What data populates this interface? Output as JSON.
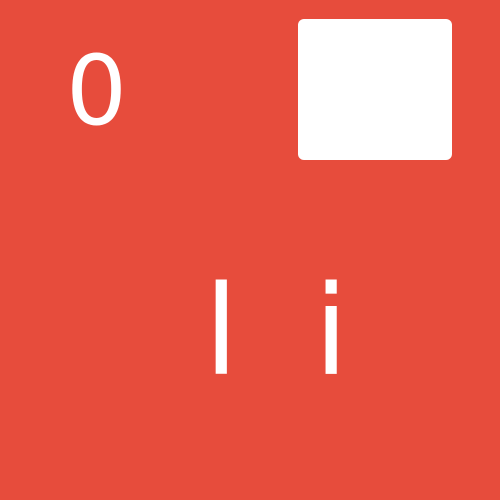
{
  "colors": {
    "background": "#e74c3c",
    "foreground": "#ffffff"
  },
  "score": {
    "value": "0"
  },
  "square": {
    "icon": "square-icon"
  },
  "text": {
    "glyphs": "l i"
  }
}
